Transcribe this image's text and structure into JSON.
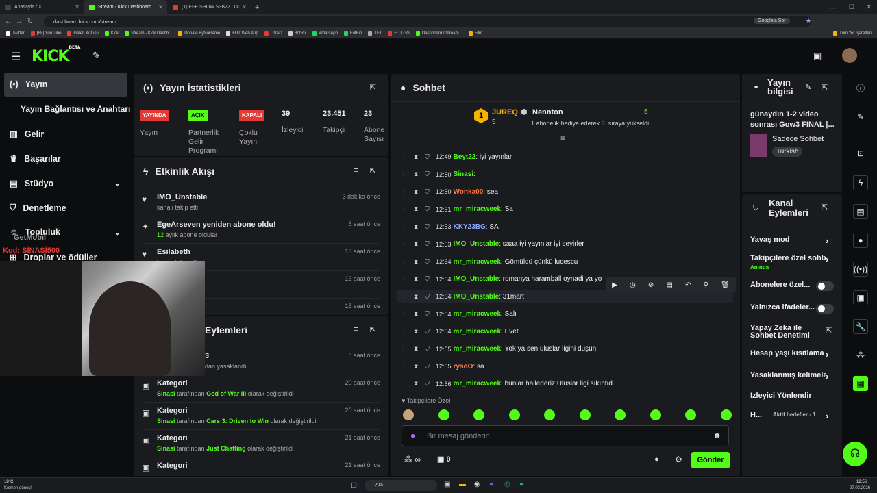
{
  "browser": {
    "tabs": [
      {
        "label": "Anasayfa / X",
        "color": "#444"
      },
      {
        "label": "Stream - Kick Dashboard",
        "color": "#53fc18"
      },
      {
        "label": "(1) EFE SHOW S3B22 | OĞUZHA...",
        "color": "#e53935"
      }
    ],
    "url": "dashboard.kick.com/stream",
    "search_label": "Google'a Sor",
    "bookmarks": [
      "Twitter",
      "(88) YouTube",
      "Gelen Kutusu",
      "Kick",
      "Stream - Kick Dashb...",
      "Donate ByNoGame",
      "FUT Web App",
      "LİVAD",
      "BotRix",
      "WhatsApp",
      "FutBin",
      "TFT",
      "FUT GG",
      "Dashboard / Stream...",
      "Film"
    ],
    "all_bookmarks": "Tüm Yer İşaretleri"
  },
  "brand": {
    "logo": "KICK",
    "beta": "BETA",
    "accent": "#53fc18"
  },
  "sidebar": {
    "items": [
      "Yayın",
      "Yayın Bağlantısı ve Anahtarı",
      "Gelir",
      "Başarılar",
      "Stüdyo",
      "Denetleme",
      "Topluluk",
      "Droplar ve ödüller"
    ]
  },
  "overlay": {
    "getmobil": "GetMobil",
    "kod": "Kod: SİNASİ500"
  },
  "stats": {
    "title": "Yayın İstatistikleri",
    "badges": [
      {
        "text": "YAYINDA",
        "bg": "#e53935",
        "fg": "#fff"
      },
      {
        "text": "AÇIK",
        "bg": "#53fc18",
        "fg": "#000"
      },
      {
        "text": "KAPALI",
        "bg": "#e53935",
        "fg": "#fff"
      }
    ],
    "labels": [
      "Yayın",
      "Partnerlik Gelir Programı",
      "Çoklu Yayın"
    ],
    "numbers": [
      {
        "value": "39",
        "label": "İzleyici"
      },
      {
        "value": "23.451",
        "label": "Takipçi"
      },
      {
        "value": "23",
        "label": "Abone Sayısı"
      }
    ]
  },
  "activity": {
    "title": "Etkinlik Akışı",
    "items": [
      {
        "title": "IMO_Unstable",
        "sub": "kanalı takip etti",
        "time": "3 dakika önce",
        "icon": "♥"
      },
      {
        "title": "EgeArseven yeniden abone oldu!",
        "sub_num": "12",
        "sub": " aylık abone oldular",
        "time": "6 saat önce",
        "icon": "✦"
      },
      {
        "title": "Esilabeth",
        "sub": "kanalı takip etti",
        "time": "13 saat önce",
        "icon": "♥"
      },
      {
        "title": "",
        "sub": "",
        "time": "13 saat önce",
        "icon": ""
      },
      {
        "title": "",
        "sub": "",
        "time": "15 saat önce",
        "icon": ""
      }
    ]
  },
  "modlog": {
    "title": "Eylemleri",
    "items": [
      {
        "title": "3",
        "sub": "dan yasaklandı",
        "time": "8 saat önce"
      },
      {
        "title": "Kategori",
        "user": "Sinasi",
        "mid": " tarafından ",
        "game": "God of War III",
        "end": " olarak değiştirildi",
        "time": "20 saat önce"
      },
      {
        "title": "Kategori",
        "user": "Sinasi",
        "mid": " tarafından ",
        "game": "Cars 3: Driven to Win",
        "end": " olarak değiştirildi",
        "time": "20 saat önce"
      },
      {
        "title": "Kategori",
        "user": "Sinasi",
        "mid": " tarafından ",
        "game": "Just Chatting",
        "end": " olarak değiştirildi",
        "time": "21 saat önce"
      },
      {
        "title": "Kategori",
        "user": "",
        "mid": "",
        "game": "",
        "end": "",
        "time": "21 saat önce"
      }
    ]
  },
  "chat": {
    "title": "Sohbet",
    "pinned": {
      "rank": "1",
      "user1": "JUREQ",
      "count1": "5",
      "user2": "Nennton",
      "count2": "5",
      "text": "1 abonelik hediye ederek 3. sıraya yükseldi"
    },
    "messages": [
      {
        "time": "12:49",
        "user": "Beyt22",
        "color": "#53fc18",
        "text": "iyi yayınlar"
      },
      {
        "time": "12:50",
        "user": "Sinasi",
        "color": "#53fc18",
        "text": ""
      },
      {
        "time": "12:50",
        "user": "Wonka00",
        "color": "#ff7a45",
        "text": "sea"
      },
      {
        "time": "12:51",
        "user": "mr_miracweek",
        "color": "#53fc18",
        "text": "Sa"
      },
      {
        "time": "12:53",
        "user": "KKY23BG",
        "color": "#8fa8ff",
        "text": "SA"
      },
      {
        "time": "12:53",
        "user": "IMO_Unstable",
        "color": "#53fc18",
        "text": "saaa iyi yayınlar iyi seyirler"
      },
      {
        "time": "12:54",
        "user": "mr_miracweek",
        "color": "#53fc18",
        "text": "Gömüldü çünkü lucescu"
      },
      {
        "time": "12:54",
        "user": "IMO_Unstable",
        "color": "#53fc18",
        "text": "romanya haramball oynadi ya yo"
      },
      {
        "time": "12:54",
        "user": "IMO_Unstable",
        "color": "#53fc18",
        "text": "31mart"
      },
      {
        "time": "12:54",
        "user": "mr_miracweek",
        "color": "#53fc18",
        "text": "Salı"
      },
      {
        "time": "12:54",
        "user": "mr_miracweek",
        "color": "#53fc18",
        "text": "Evet"
      },
      {
        "time": "12:55",
        "user": "mr_miracweek",
        "color": "#53fc18",
        "text": "Yok ya sen uluslar ligini düşün"
      },
      {
        "time": "12:55",
        "user": "rysoO",
        "color": "#ff7a45",
        "text": "sa"
      },
      {
        "time": "12:56",
        "user": "mr_miracweek",
        "color": "#53fc18",
        "text": "bunlar hallederiz Uluslar ligi sıkıntıd"
      }
    ],
    "emote_label": "Takipçilere Özel",
    "input_placeholder": "Bir mesaj gönderin",
    "points": "∞",
    "gift_count": "0",
    "send": "Gönder"
  },
  "info": {
    "title": "Yayın bilgisi",
    "stream_title": "günaydın 1-2 video sonrası Gow3 FINAL |...",
    "category": "Sadece Sohbet",
    "language": "Turkish"
  },
  "channel": {
    "title": "Kanal Eylemleri",
    "items": [
      {
        "label": "Yavaş mod",
        "type": "chev"
      },
      {
        "label": "Takipçilere özel sohb",
        "sub": "Anında",
        "type": "chev"
      },
      {
        "label": "Abonelere özel...",
        "type": "toggle"
      },
      {
        "label": "Yalnızca ifadeler...",
        "type": "toggle"
      },
      {
        "label": "Yapay Zeka ile Sohbet Denetimi",
        "type": "ext"
      },
      {
        "label": "Hesap yaşı kısıtlama",
        "type": "chev"
      },
      {
        "label": "Yasaklanmış kelimele",
        "type": "chev"
      },
      {
        "label": "İzleyici Yönlendir",
        "type": "none"
      },
      {
        "label": "H...",
        "sub": "Aktif hedefler - 1",
        "type": "chev"
      }
    ]
  },
  "taskbar": {
    "temp": "18°C",
    "weather": "Kısmen güneşli",
    "search": "Ara",
    "time": "12:56",
    "date": "27.03.2026"
  }
}
